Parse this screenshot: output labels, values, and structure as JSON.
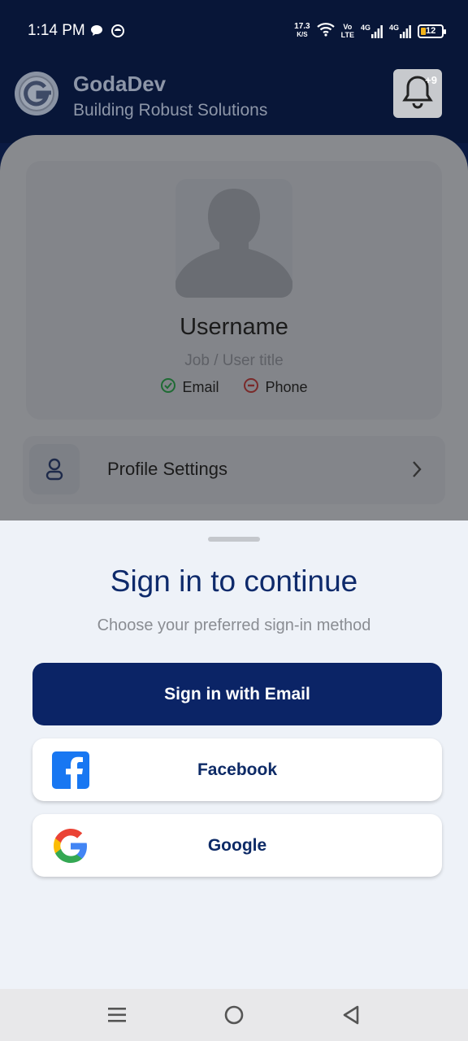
{
  "status_bar": {
    "time": "1:14 PM",
    "net_speed_value": "17.3",
    "net_speed_unit": "K/S",
    "volte_top": "Vo",
    "volte_bottom": "LTE",
    "sim1": "4G",
    "sim2": "4G",
    "battery": "12",
    "battery_color": "#f2b31b"
  },
  "header": {
    "title": "GodaDev",
    "subtitle": "Building Robust Solutions",
    "notification_badge": "+9"
  },
  "profile": {
    "username": "Username",
    "job_title": "Job / User title",
    "email_label": "Email",
    "phone_label": "Phone",
    "email_status_color": "#1f8a3a",
    "phone_status_color": "#9b2c2c"
  },
  "settings": {
    "profile_settings_label": "Profile Settings"
  },
  "sheet": {
    "title": "Sign in to continue",
    "subtitle": "Choose your preferred sign-in method",
    "email_button": "Sign in with Email",
    "facebook_button": "Facebook",
    "google_button": "Google",
    "accent": "#0b2466"
  },
  "nav": {
    "icons": [
      "menu-icon",
      "home-circle-icon",
      "back-triangle-icon"
    ]
  }
}
